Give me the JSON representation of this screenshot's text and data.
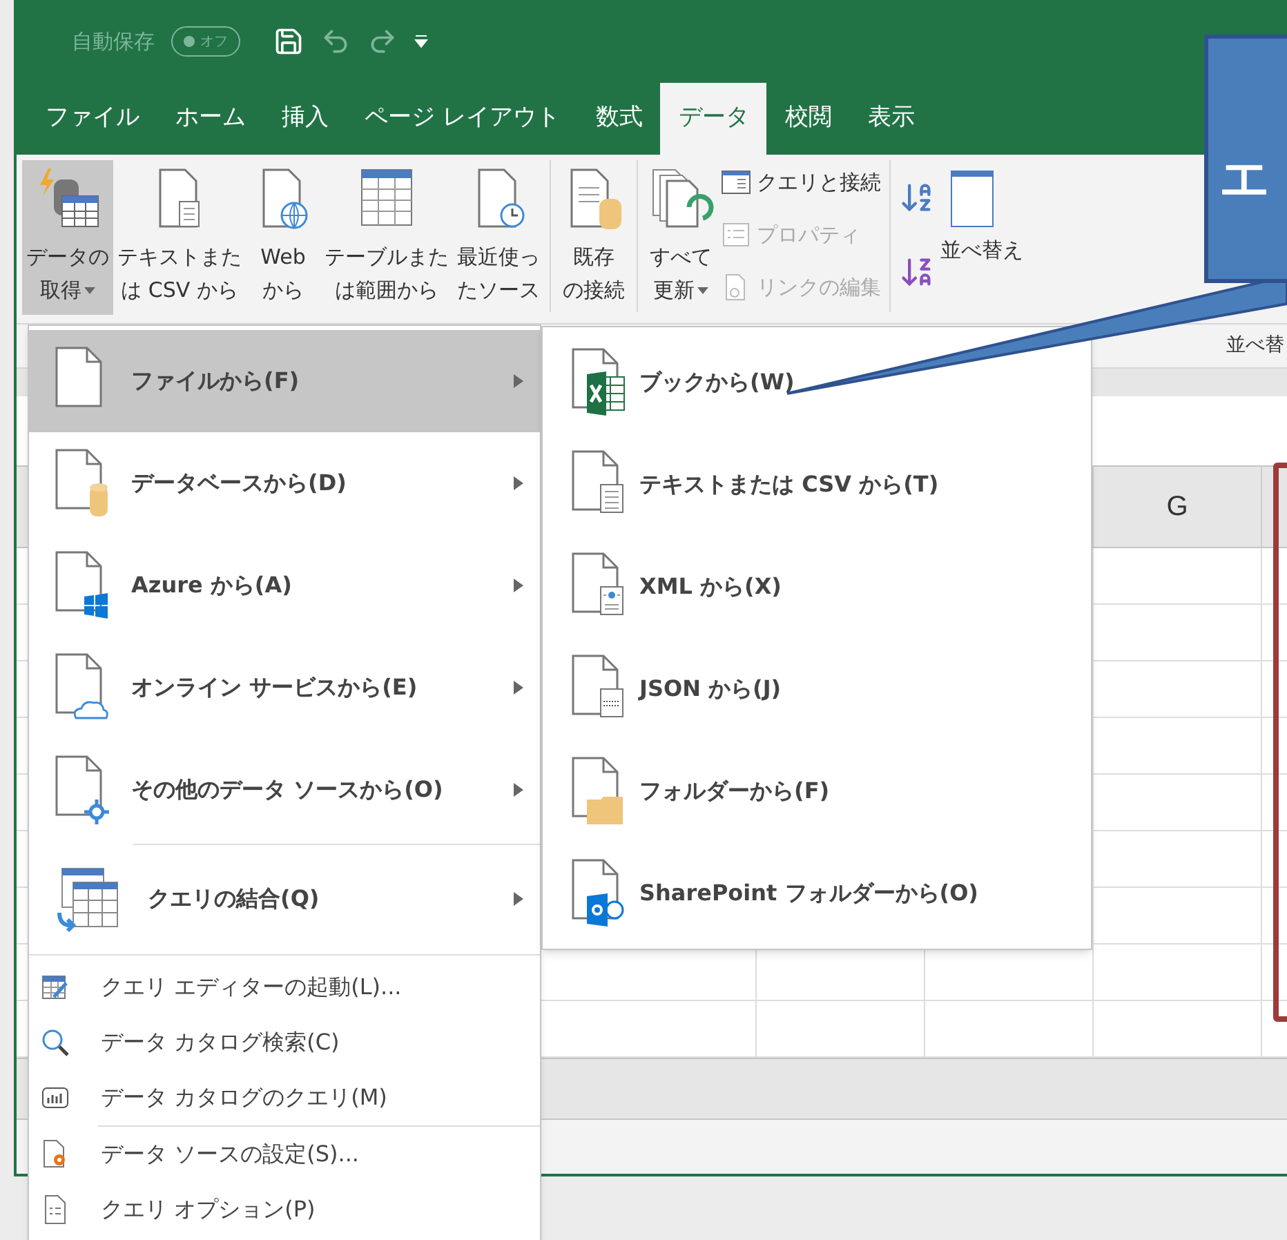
{
  "quick_access": {
    "autosave_label": "自動保存",
    "autosave_toggle": {
      "label": "オフ",
      "on": false
    }
  },
  "tabs": [
    {
      "label": "ファイル",
      "selected": false
    },
    {
      "label": "ホーム",
      "selected": false
    },
    {
      "label": "挿入",
      "selected": false
    },
    {
      "label": "ページ レイアウト",
      "selected": false
    },
    {
      "label": "数式",
      "selected": false
    },
    {
      "label": "データ",
      "selected": true
    },
    {
      "label": "校閲",
      "selected": false
    },
    {
      "label": "表示",
      "selected": false
    }
  ],
  "ribbon": {
    "buttons": [
      {
        "kind": "get-data",
        "lines": [
          "データの",
          "取得"
        ],
        "selected": true,
        "dropdown": true
      },
      {
        "kind": "text",
        "lines": [
          "テキストまた",
          "は CSV から"
        ],
        "selected": false,
        "dropdown": false
      },
      {
        "kind": "web",
        "lines": [
          "Web",
          "から"
        ],
        "selected": false,
        "dropdown": false
      },
      {
        "kind": "table",
        "lines": [
          "テーブルまた",
          "は範囲から"
        ],
        "selected": false,
        "dropdown": false
      },
      {
        "kind": "recent",
        "lines": [
          "最近使っ",
          "たソース"
        ],
        "selected": false,
        "dropdown": false
      },
      {
        "kind": "existing",
        "lines": [
          "既存",
          "の接続"
        ],
        "selected": false,
        "dropdown": false
      },
      {
        "kind": "refresh",
        "lines": [
          "すべて",
          "更新"
        ],
        "selected": false,
        "dropdown": true
      }
    ],
    "small_buttons": [
      {
        "kind": "queries",
        "label": "クエリと接続",
        "disabled": false
      },
      {
        "kind": "properties",
        "label": "プロパティ",
        "disabled": true
      },
      {
        "kind": "links",
        "label": "リンクの編集",
        "disabled": true
      }
    ],
    "sort_label": "並べ替え"
  },
  "group_label": "並べ替",
  "sheet": {
    "column_label": "G"
  },
  "get_data_menu": {
    "items": [
      {
        "kind": "file",
        "label": "ファイルから(F)",
        "selected": true
      },
      {
        "kind": "database",
        "label": "データベースから(D)",
        "selected": false
      },
      {
        "kind": "azure",
        "label": "Azure から(A)",
        "selected": false
      },
      {
        "kind": "online",
        "label": "オンライン サービスから(E)",
        "selected": false
      },
      {
        "kind": "other",
        "label": "その他のデータ ソースから(O)",
        "selected": false
      },
      {
        "kind": "combine",
        "label": "クエリの結合(Q)",
        "selected": false
      }
    ],
    "commands": [
      {
        "kind": "editor",
        "label": "クエリ エディターの起動(L)..."
      },
      {
        "kind": "search",
        "label": "データ カタログ検索(C)"
      },
      {
        "kind": "catalog",
        "label": "データ カタログのクエリ(M)"
      },
      {
        "kind": "settings",
        "label": "データ ソースの設定(S)..."
      },
      {
        "kind": "options",
        "label": "クエリ オプション(P)"
      }
    ]
  },
  "file_submenu": {
    "items": [
      {
        "kind": "excel",
        "label": "ブックから(W)"
      },
      {
        "kind": "text",
        "label": "テキストまたは CSV から(T)"
      },
      {
        "kind": "xml",
        "label": "XML から(X)"
      },
      {
        "kind": "json",
        "label": "JSON から(J)"
      },
      {
        "kind": "folder",
        "label": "フォルダーから(F)"
      },
      {
        "kind": "sharepoint",
        "label": "SharePoint フォルダーから(O)"
      }
    ]
  },
  "callout": {
    "text": "エ"
  }
}
